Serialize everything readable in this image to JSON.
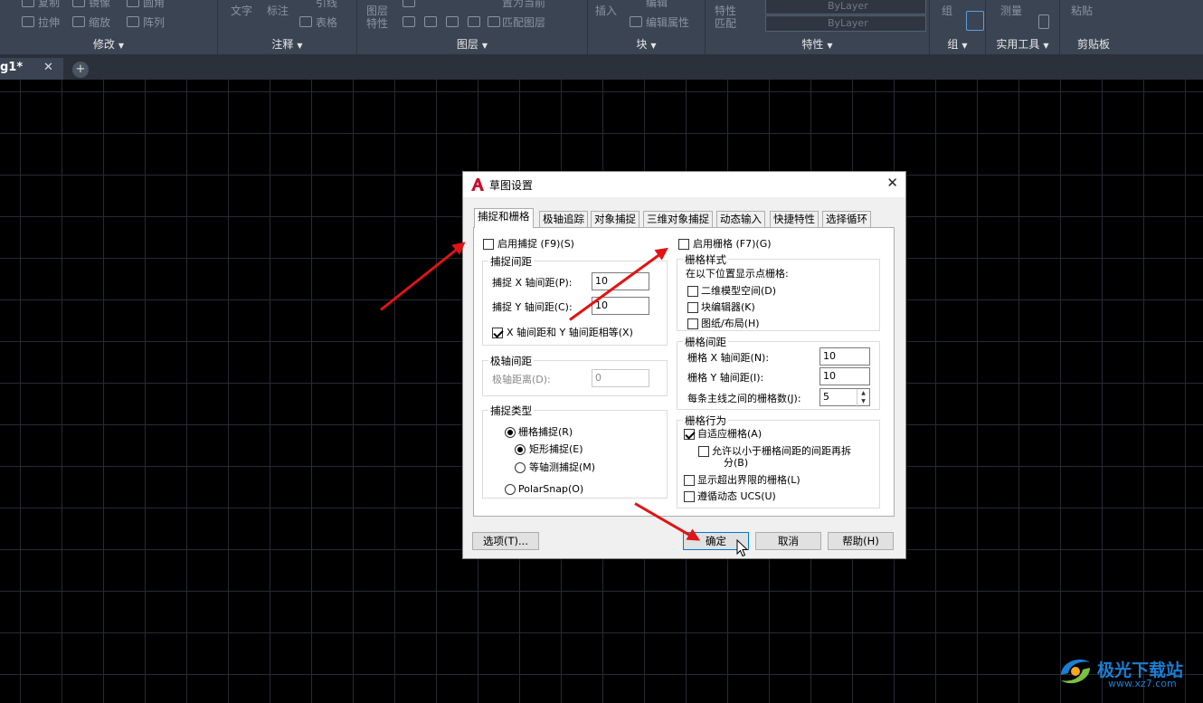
{
  "ribbon": {
    "modify": {
      "title": "修改",
      "items": [
        "复制",
        "镜像",
        "圆角",
        "拉伸",
        "缩放",
        "阵列"
      ]
    },
    "annotate": {
      "title": "注释",
      "items": [
        "文字",
        "标注",
        "引线",
        "表格"
      ]
    },
    "layers": {
      "title": "图层",
      "items": [
        "图层特性",
        "置为当前",
        "匹配图层"
      ]
    },
    "block": {
      "title": "块",
      "items": [
        "插入",
        "编辑",
        "编辑属性"
      ]
    },
    "properties": {
      "title": "特性",
      "items": [
        "特性匹配"
      ],
      "linetype": "ByLayer",
      "lineweight": "ByLayer"
    },
    "groups": {
      "title": "组",
      "items": [
        "组"
      ]
    },
    "utilities": {
      "title": "实用工具",
      "items": [
        "测量"
      ]
    },
    "clipboard": {
      "title": "剪贴板",
      "items": [
        "粘贴"
      ]
    }
  },
  "doc_tab": {
    "label": "g1*",
    "close": "✕",
    "new": "+"
  },
  "dialog": {
    "title": "草图设置",
    "close": "✕",
    "tabs": [
      "捕捉和栅格",
      "极轴追踪",
      "对象捕捉",
      "三维对象捕捉",
      "动态输入",
      "快捷特性",
      "选择循环"
    ],
    "active_tab": "捕捉和栅格",
    "snap_on": {
      "label": "启用捕捉 (F9)(S)",
      "checked": false
    },
    "snap_spacing": {
      "title": "捕捉间距",
      "x_label": "捕捉 X 轴间距(P):",
      "x_value": "10",
      "y_label": "捕捉 Y 轴间距(C):",
      "y_value": "10",
      "equal_label": "X 轴间距和 Y 轴间距相等(X)",
      "equal_checked": true
    },
    "polar_spacing": {
      "title": "极轴间距",
      "dist_label": "极轴距离(D):",
      "dist_value": "0"
    },
    "snap_type": {
      "title": "捕捉类型",
      "grid_snap": "栅格捕捉(R)",
      "rect_snap": "矩形捕捉(E)",
      "iso_snap": "等轴测捕捉(M)",
      "polar_snap": "PolarSnap(O)"
    },
    "grid_on": {
      "label": "启用栅格 (F7)(G)",
      "checked": false
    },
    "grid_style": {
      "title": "栅格样式",
      "desc": "在以下位置显示点栅格:",
      "model": "二维模型空间(D)",
      "block_editor": "块编辑器(K)",
      "paper": "图纸/布局(H)"
    },
    "grid_spacing": {
      "title": "栅格间距",
      "x_label": "栅格 X 轴间距(N):",
      "x_value": "10",
      "y_label": "栅格 Y 轴间距(I):",
      "y_value": "10",
      "major_label": "每条主线之间的栅格数(J):",
      "major_value": "5"
    },
    "grid_behavior": {
      "title": "栅格行为",
      "adaptive": "自适应栅格(A)",
      "subdivide_line1": "允许以小于栅格间距的间距再拆",
      "subdivide_line2": "分(B)",
      "beyond": "显示超出界限的栅格(L)",
      "follow_ucs": "遵循动态 UCS(U)"
    },
    "buttons": {
      "options": "选项(T)...",
      "ok": "确定",
      "cancel": "取消",
      "help": "帮助(H)"
    }
  },
  "watermark": {
    "text": "极光下载站",
    "url": "www.xz7.com"
  },
  "colors": {
    "ribbon": "#3b4453",
    "canvas": "#000000",
    "grid": "#262b33",
    "accent": "#0078d7",
    "arrow": "#e01414",
    "autocad": "#c8102e",
    "watermark": "#1a7fd4"
  }
}
